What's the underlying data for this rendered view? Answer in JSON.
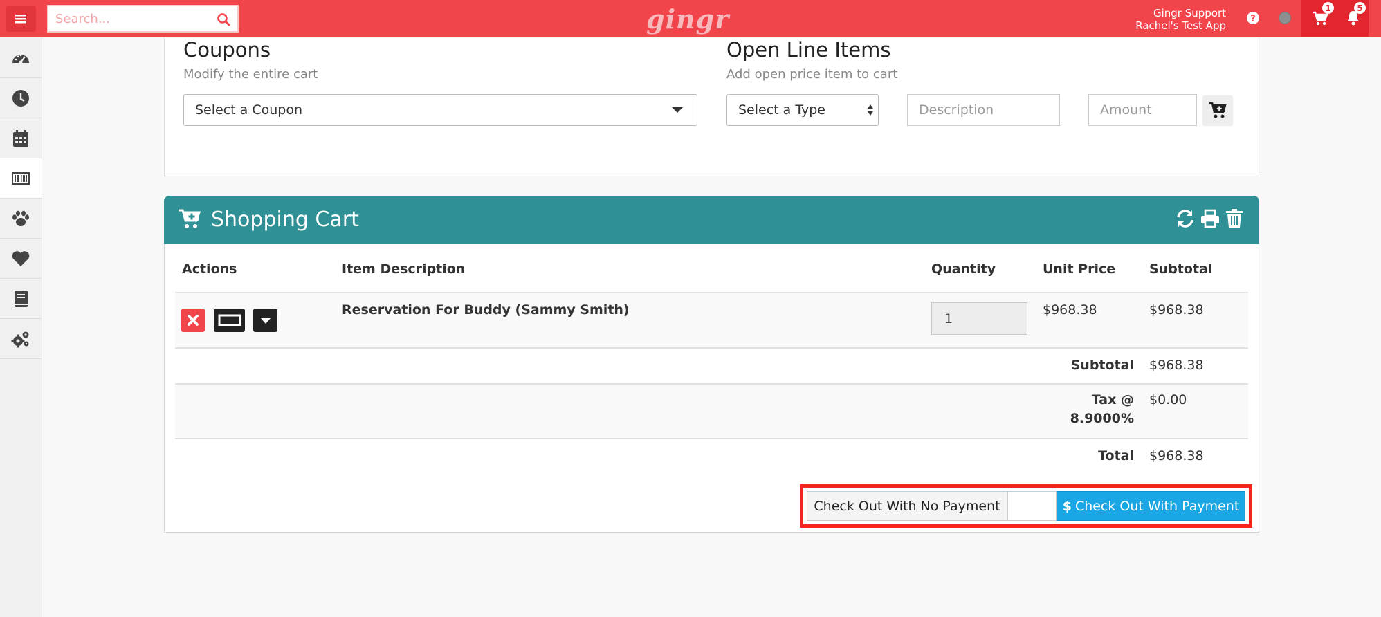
{
  "app": {
    "logo": "gingr",
    "search_placeholder": "Search...",
    "user": "Gingr Support",
    "company": "Rachel's Test App",
    "cart_count": "1",
    "notification_count": "5",
    "accent_color": "#f2444b",
    "cart_header_color": "#2f9095",
    "pay_button_color": "#1ba6e5"
  },
  "sidebar": {
    "items": [
      {
        "icon": "dashboard-icon"
      },
      {
        "icon": "clock-icon"
      },
      {
        "icon": "calendar-icon"
      },
      {
        "icon": "barcode-icon"
      },
      {
        "icon": "paw-icon"
      },
      {
        "icon": "heart-icon"
      },
      {
        "icon": "book-icon"
      },
      {
        "icon": "gears-icon"
      }
    ]
  },
  "coupons": {
    "title": "Coupons",
    "subtitle": "Modify the entire cart",
    "select_label": "Select a Coupon"
  },
  "open_line_items": {
    "title": "Open Line Items",
    "subtitle": "Add open price item to cart",
    "type_label": "Select a Type",
    "description_placeholder": "Description",
    "amount_placeholder": "Amount"
  },
  "cart": {
    "title": "Shopping Cart",
    "columns": {
      "actions": "Actions",
      "description": "Item Description",
      "quantity": "Quantity",
      "unit_price": "Unit Price",
      "subtotal": "Subtotal"
    },
    "items": [
      {
        "description": "Reservation For Buddy (Sammy Smith)",
        "quantity": "1",
        "unit_price": "$968.38",
        "subtotal": "$968.38"
      }
    ],
    "summary": {
      "subtotal_label": "Subtotal",
      "subtotal_value": "$968.38",
      "tax_label_line1": "Tax @",
      "tax_label_line2": "8.9000%",
      "tax_value": "$0.00",
      "total_label": "Total",
      "total_value": "$968.38"
    },
    "checkout_no_payment": "Check Out With No Payment",
    "checkout_with_payment": "Check Out With Payment"
  }
}
